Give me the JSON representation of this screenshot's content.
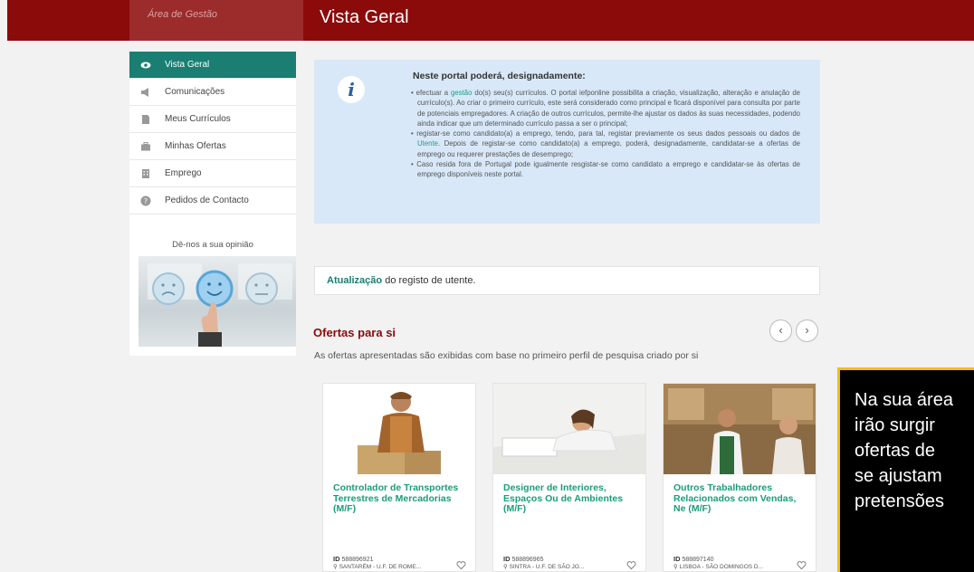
{
  "header": {
    "area_label": "Área de Gestão",
    "page_title": "Vista Geral"
  },
  "sidebar": {
    "items": [
      {
        "label": "Vista Geral",
        "icon": "eye-icon"
      },
      {
        "label": "Comunicações",
        "icon": "megaphone-icon"
      },
      {
        "label": "Meus Currículos",
        "icon": "document-icon"
      },
      {
        "label": "Minhas Ofertas",
        "icon": "briefcase-icon"
      },
      {
        "label": "Emprego",
        "icon": "building-icon"
      },
      {
        "label": "Pedidos de Contacto",
        "icon": "question-icon"
      }
    ],
    "opinion_label": "Dê-nos a sua opinião"
  },
  "info": {
    "title": "Neste portal poderá, designadamente:",
    "b1_pre": "efectuar a ",
    "b1_link": "gestão",
    "b1_post": " do(s) seu(s) currículos. O portal iefponline possibilita a criação, visualização, alteração e anulação de currículo(s). Ao criar o primeiro currículo, este será considerado como principal e ficará disponível para consulta por parte de potenciais empregadores. A criação de outros currículos, permite-lhe ajustar os dados às suas necessidades, podendo ainda indicar que um determinado currículo passa a ser o principal;",
    "b2_pre": "registar-se como candidato(a) a emprego, tendo, para tal, registar previamente os seus dados pessoais ou dados de ",
    "b2_link": "Utente",
    "b2_post": ". Depois de registar-se como candidato(a) a emprego, poderá, designadamente, candidatar-se a ofertas de emprego ou requerer prestações de desemprego;",
    "b3": "Caso resida fora de Portugal pode igualmente resgistar-se como candidato a emprego e candidatar-se às ofertas de emprego disponíveis neste portal."
  },
  "update": {
    "link": "Atualização",
    "text": " do registo de utente."
  },
  "offers": {
    "title": "Ofertas para si",
    "subtitle": "As ofertas apresentadas são exibidas com base no primeiro perfil de pesquisa criado por si",
    "prev": "‹",
    "next": "›",
    "cards": [
      {
        "title": "Controlador de Transportes Terrestres de Mercadorias (M/F)",
        "id_label": "ID",
        "id": "588896921",
        "location": "SANTARÉM - U.F. DE ROME..."
      },
      {
        "title": "Designer de Interiores, Espaços Ou de Ambientes (M/F)",
        "id_label": "ID",
        "id": "588896965",
        "location": "SINTRA - U.F. DE SÃO JO..."
      },
      {
        "title": "Outros Trabalhadores Relacionados com Vendas, Ne (M/F)",
        "id_label": "ID",
        "id": "588897140",
        "location": "LISBOA - SÃO DOMINGOS D..."
      }
    ]
  },
  "tooltip": {
    "text": "Na sua área\nirão surgir\nofertas de\nse ajustam\npretensões"
  },
  "colors": {
    "header": "#8b0a0a",
    "accent": "#1a7e72",
    "info_bg": "#d8e8f8",
    "tooltip_border": "#f0c000"
  }
}
